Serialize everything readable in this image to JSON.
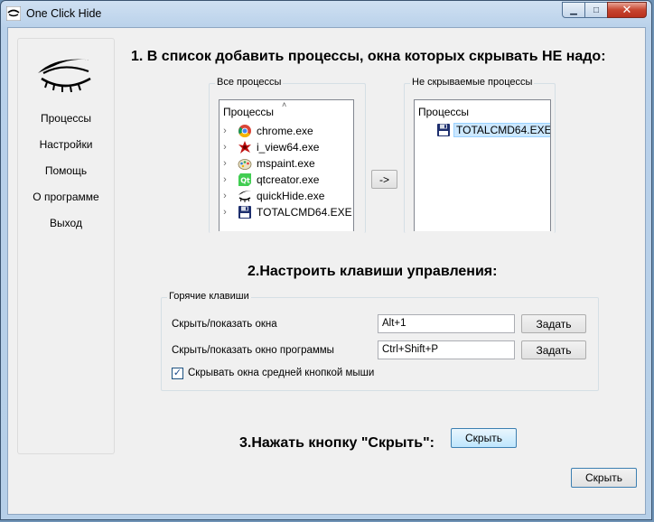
{
  "window": {
    "title": "One Click Hide",
    "minimize_glyph": "▁",
    "maximize_glyph": "□",
    "close_glyph": "✕"
  },
  "sidebar": {
    "items": [
      {
        "label": "Процессы"
      },
      {
        "label": "Настройки"
      },
      {
        "label": "Помощь"
      },
      {
        "label": "О программе"
      },
      {
        "label": "Выход"
      }
    ]
  },
  "step1": {
    "heading": "1. В список добавить процессы, окна которых скрывать НЕ надо:",
    "all_group_title": "Все процессы",
    "all_header": "Процессы",
    "all_processes": [
      {
        "name": "chrome.exe",
        "icon": "chrome-icon"
      },
      {
        "name": "i_view64.exe",
        "icon": "irfanview-icon"
      },
      {
        "name": "mspaint.exe",
        "icon": "paint-icon"
      },
      {
        "name": "qtcreator.exe",
        "icon": "qt-icon"
      },
      {
        "name": "quickHide.exe",
        "icon": "eye-icon"
      },
      {
        "name": "TOTALCMD64.EXE",
        "icon": "floppy-icon"
      }
    ],
    "add_button_label": "->",
    "kept_group_title": "Не скрываемые процессы",
    "kept_header": "Процессы",
    "kept_processes": [
      {
        "name": "TOTALCMD64.EXE",
        "icon": "floppy-icon"
      }
    ],
    "scroll_up_glyph": "˄"
  },
  "step2": {
    "heading": "2.Настроить клавиши управления:",
    "group_title": "Горячие клавиши",
    "rows": [
      {
        "label": "Скрыть/показать окна",
        "value": "Alt+1",
        "button": "Задать"
      },
      {
        "label": "Скрыть/показать окно программы",
        "value": "Ctrl+Shift+P",
        "button": "Задать"
      }
    ],
    "middle_click_label": "Скрывать окна средней кнопкой мыши",
    "middle_click_checked": true,
    "check_glyph": "✓"
  },
  "step3": {
    "heading": "3.Нажать кнопку \"Скрыть\":",
    "hide_button": "Скрыть"
  },
  "footer": {
    "hide_button": "Скрыть"
  }
}
